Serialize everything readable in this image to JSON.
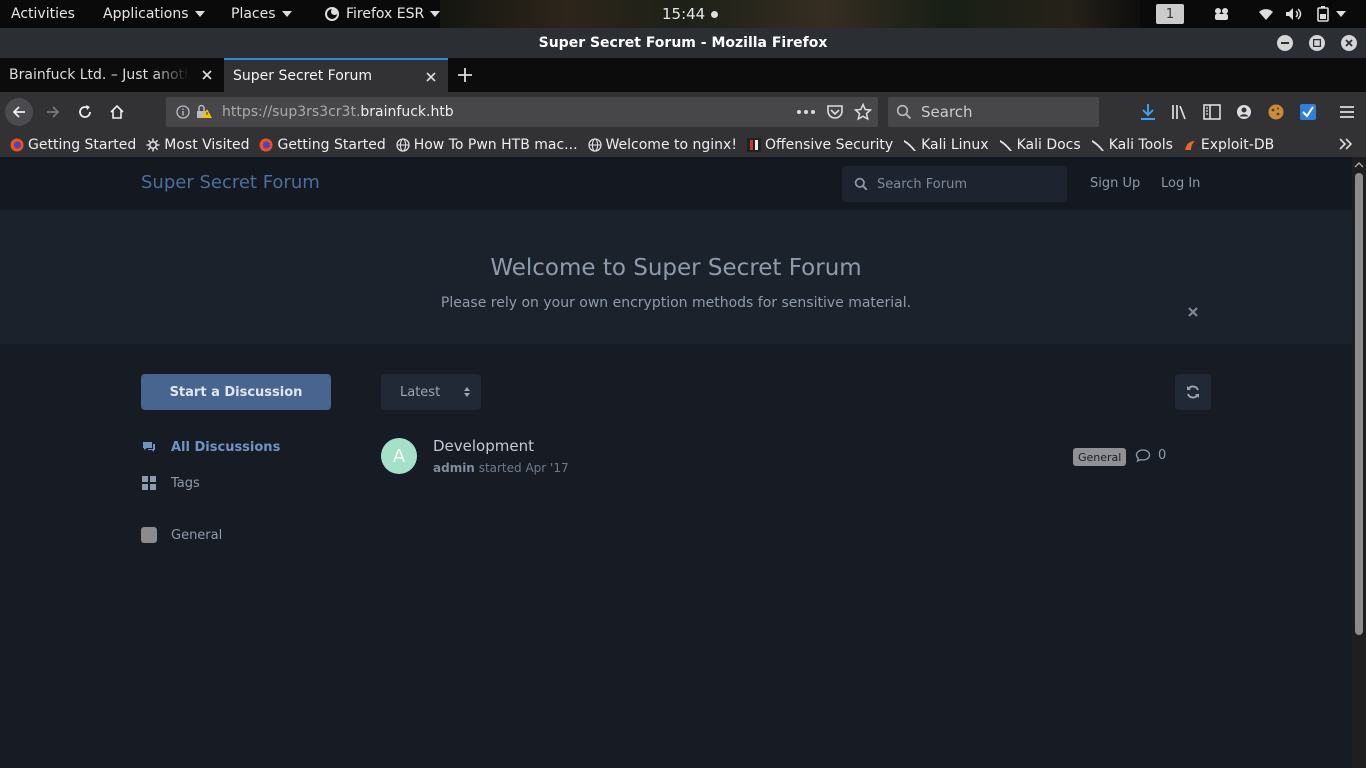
{
  "topbar": {
    "activities": "Activities",
    "applications": "Applications",
    "places": "Places",
    "firefox": "Firefox ESR",
    "clock": "15:44",
    "workspace": "1"
  },
  "window": {
    "title": "Super Secret Forum - Mozilla Firefox"
  },
  "tabs": [
    {
      "label": "Brainfuck Ltd. – Just another WordPress site"
    },
    {
      "label": "Super Secret Forum"
    }
  ],
  "navbar": {
    "url_prefix": "https://sup3rs3cr3t.",
    "url_domain": "brainfuck.htb",
    "search_placeholder": "Search"
  },
  "bookmarks": [
    {
      "label": "Getting Started",
      "icon": "firefox-icon"
    },
    {
      "label": "Most Visited",
      "icon": "gear-icon"
    },
    {
      "label": "Getting Started",
      "icon": "firefox-icon"
    },
    {
      "label": "How To Pwn HTB mac...",
      "icon": "globe-icon"
    },
    {
      "label": "Welcome to nginx!",
      "icon": "globe-icon"
    },
    {
      "label": "Offensive Security",
      "icon": "offsec-icon"
    },
    {
      "label": "Kali Linux",
      "icon": "kali-icon"
    },
    {
      "label": "Kali Docs",
      "icon": "kali-icon"
    },
    {
      "label": "Kali Tools",
      "icon": "kali-icon"
    },
    {
      "label": "Exploit-DB",
      "icon": "exploitdb-icon"
    }
  ],
  "forum": {
    "title": "Super Secret Forum",
    "search_placeholder": "Search Forum",
    "sign_up": "Sign Up",
    "log_in": "Log In",
    "hero_title": "Welcome to Super Secret Forum",
    "hero_subtitle": "Please rely on your own encryption methods for sensitive material.",
    "start_discussion": "Start a Discussion",
    "nav": {
      "all_discussions": "All Discussions",
      "tags": "Tags",
      "general": "General"
    },
    "sort_label": "Latest",
    "discussions": [
      {
        "avatar_letter": "A",
        "title": "Development",
        "author": "admin",
        "started": "started Apr '17",
        "tag": "General",
        "replies": "0"
      }
    ]
  }
}
